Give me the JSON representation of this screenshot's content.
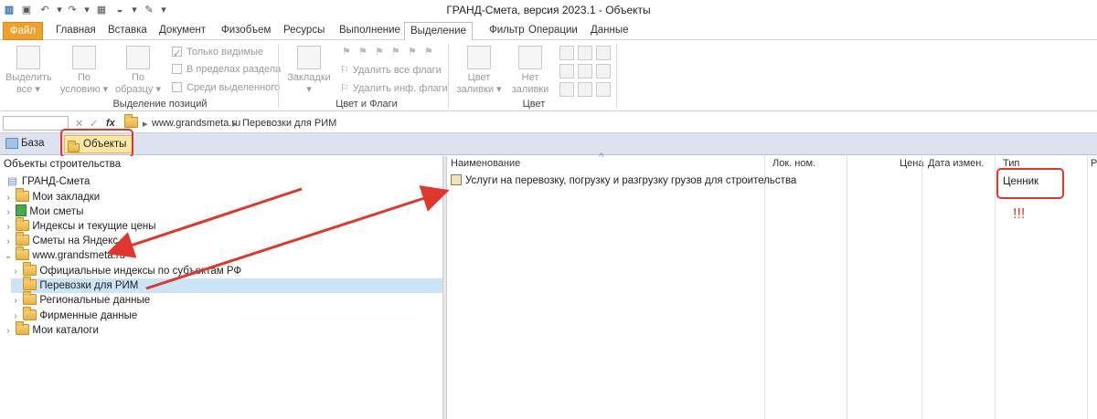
{
  "window": {
    "title": "ГРАНД-Смета, версия 2023.1 - Объекты"
  },
  "menu": {
    "tabs": [
      "Файл",
      "Главная",
      "Вставка",
      "Документ",
      "Физобъем",
      "Ресурсы",
      "Выполнение",
      "Выделение",
      "Фильтр",
      "Операции",
      "Данные"
    ],
    "active": "Выделение"
  },
  "ribbon": {
    "select_all": [
      "Выделить",
      "все"
    ],
    "by_condition": [
      "По",
      "условию"
    ],
    "by_sample": [
      "По",
      "образцу"
    ],
    "only_visible": "Только видимые",
    "within_section": "В пределах раздела",
    "among_selected": "Среди выделенного",
    "group_positions": "Выделение позиций",
    "bookmarks": "Закладки",
    "remove_all_flags": "Удалить все флаги",
    "remove_info_flags": "Удалить инф. флаги",
    "fill_color": [
      "Цвет",
      "заливки"
    ],
    "no_fill": [
      "Нет",
      "заливки"
    ],
    "group_color_flags": "Цвет и Флаги",
    "group_color": "Цвет"
  },
  "address": {
    "crumbs": [
      "www.grandsmeta.ru",
      "Перевозки для РИМ"
    ]
  },
  "doc_tabs": {
    "base": "База",
    "objects": "Объекты"
  },
  "tree": {
    "header": "Объекты строительства",
    "root": "ГРАНД-Смета",
    "items": [
      "Мои закладки",
      "Мои сметы",
      "Индексы и текущие цены",
      "Сметы на Яндекс",
      "www.grandsmeta.ru",
      "Официальные индексы по субъектам РФ",
      "Перевозки для РИМ",
      "Региональные данные",
      "Фирменные данные",
      "Мои каталоги"
    ]
  },
  "table": {
    "columns": [
      "Наименование",
      "Лок. ном.",
      "Цена",
      "Дата измен.",
      "Тип",
      "Р"
    ],
    "rows": [
      {
        "name": "Услуги на перевозку, погрузку и разгрузку грузов для строительства",
        "type": "Ценник"
      }
    ]
  },
  "annotation": {
    "exclaim": "!!!"
  },
  "colors": {
    "annotation_red": "#e0362b",
    "active_tab": "#fde7a6",
    "file_tab": "#f0a12b",
    "selection": "#cce4f7"
  }
}
